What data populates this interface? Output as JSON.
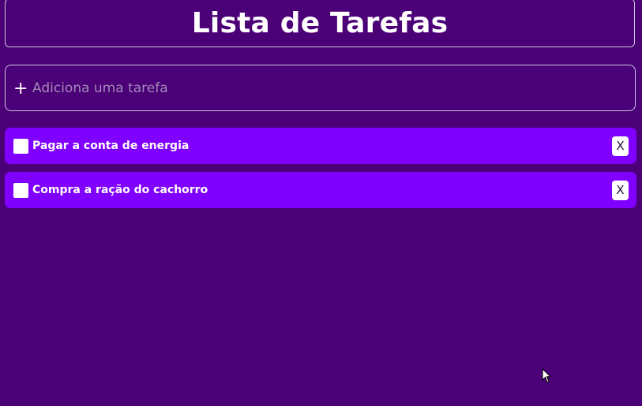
{
  "header": {
    "title": "Lista de Tarefas"
  },
  "add_task": {
    "icon": "plus-icon",
    "icon_glyph": "+",
    "placeholder": "Adiciona uma tarefa",
    "value": ""
  },
  "tasks": [
    {
      "label": "Pagar a conta de energia",
      "checked": false,
      "delete_label": "X"
    },
    {
      "label": "Compra a ração do cachorro",
      "checked": false,
      "delete_label": "X"
    }
  ],
  "colors": {
    "background": "#4b0077",
    "task_background": "#8000ff",
    "border": "#cfc3e0",
    "text": "#ffffff"
  }
}
